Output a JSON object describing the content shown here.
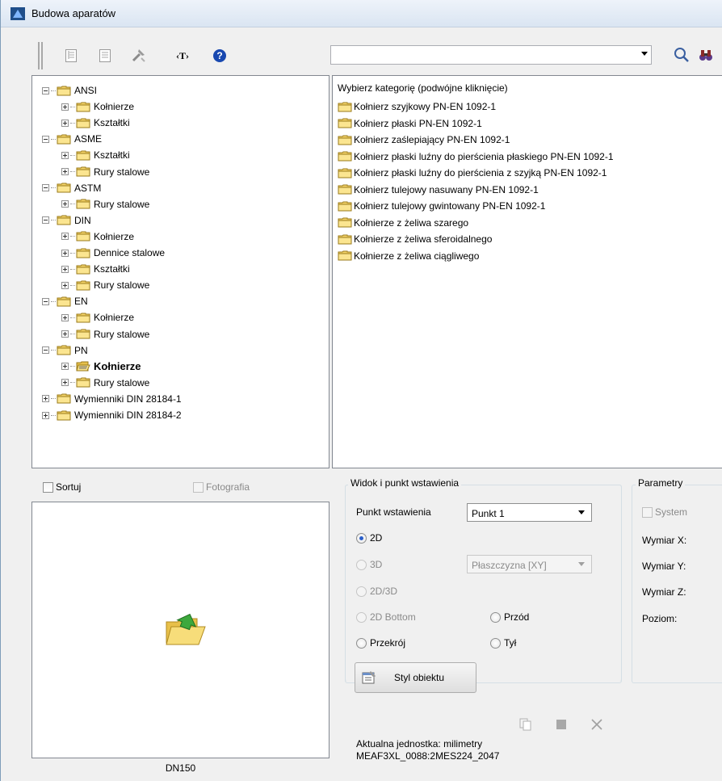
{
  "window": {
    "title": "Budowa aparatów"
  },
  "search": {
    "value": ""
  },
  "tree": {
    "items": [
      {
        "label": "ANSI",
        "level": 0,
        "expanded": true
      },
      {
        "label": "Kołnierze",
        "level": 1,
        "expanded": false
      },
      {
        "label": "Kształtki",
        "level": 1,
        "expanded": false
      },
      {
        "label": "ASME",
        "level": 0,
        "expanded": true
      },
      {
        "label": "Kształtki",
        "level": 1,
        "expanded": false
      },
      {
        "label": "Rury stalowe",
        "level": 1,
        "expanded": false
      },
      {
        "label": "ASTM",
        "level": 0,
        "expanded": true
      },
      {
        "label": "Rury stalowe",
        "level": 1,
        "expanded": false
      },
      {
        "label": "DIN",
        "level": 0,
        "expanded": true
      },
      {
        "label": "Kołnierze",
        "level": 1,
        "expanded": false
      },
      {
        "label": "Dennice stalowe",
        "level": 1,
        "expanded": false
      },
      {
        "label": "Kształtki",
        "level": 1,
        "expanded": false
      },
      {
        "label": "Rury stalowe",
        "level": 1,
        "expanded": false
      },
      {
        "label": "EN",
        "level": 0,
        "expanded": true
      },
      {
        "label": "Kołnierze",
        "level": 1,
        "expanded": false
      },
      {
        "label": "Rury stalowe",
        "level": 1,
        "expanded": false
      },
      {
        "label": "PN",
        "level": 0,
        "expanded": true
      },
      {
        "label": "Kołnierze",
        "level": 1,
        "expanded": false,
        "selected": true
      },
      {
        "label": "Rury stalowe",
        "level": 1,
        "expanded": false
      },
      {
        "label": "Wymienniki DIN 28184-1",
        "level": 0,
        "expanded": false
      },
      {
        "label": "Wymienniki DIN 28184-2",
        "level": 0,
        "expanded": false
      }
    ]
  },
  "list": {
    "header": "Wybierz kategorię (podwójne kliknięcie)",
    "items": [
      "Kołnierz szyjkowy PN-EN 1092-1",
      "Kołnierz płaski PN-EN 1092-1",
      "Kołnierz zaślepiający PN-EN 1092-1",
      "Kołnierz płaski luźny do pierścienia płaskiego PN-EN 1092-1",
      "Kołnierz płaski luźny do pierścienia z szyjką PN-EN 1092-1",
      "Kołnierz tulejowy nasuwany PN-EN 1092-1",
      "Kołnierz tulejowy gwintowany PN-EN 1092-1",
      "Kołnierze z żeliwa szarego",
      "Kołnierze z żeliwa sferoidalnego",
      "Kołnierze z żeliwa ciągliwego"
    ]
  },
  "options": {
    "sort": "Sortuj",
    "photo": "Fotografia"
  },
  "preview": {
    "caption": "DN150"
  },
  "view": {
    "title": "Widok i punkt wstawienia",
    "insert_label": "Punkt wstawienia",
    "insert_value": "Punkt 1",
    "plane_value": "Płaszczyzna  [XY]",
    "r2d": "2D",
    "r3d": "3D",
    "r2d3d": "2D/3D",
    "r2dbottom": "2D Bottom",
    "rfront": "Przód",
    "rsection": "Przekrój",
    "rback": "Tył",
    "style_button": "Styl obiektu"
  },
  "params": {
    "title": "Parametry",
    "system": "System",
    "x": "Wymiar X:",
    "y": "Wymiar Y:",
    "z": "Wymiar Z:",
    "level": "Poziom:"
  },
  "status": {
    "unit": "Aktualna jednostka: milimetry",
    "code": "MEAF3XL_0088:2MES224_2047"
  }
}
